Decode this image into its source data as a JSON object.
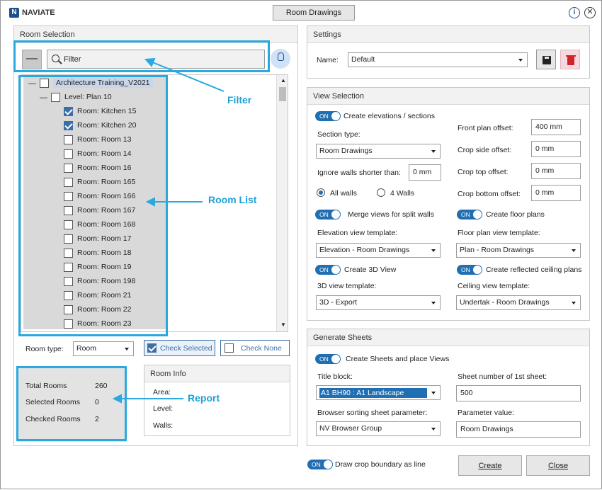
{
  "app": {
    "logo": "NAVIATE",
    "title_tab": "Room Drawings"
  },
  "room_selection": {
    "title": "Room Selection",
    "filter_placeholder": "Filter",
    "tree_root": "Architecture Training_V2021",
    "tree_level": "Level: Plan 10",
    "rooms": [
      {
        "label": "Room: Kitchen 15",
        "checked": true
      },
      {
        "label": "Room: Kitchen 20",
        "checked": true
      },
      {
        "label": "Room: Room 13",
        "checked": false
      },
      {
        "label": "Room: Room 14",
        "checked": false
      },
      {
        "label": "Room: Room 16",
        "checked": false
      },
      {
        "label": "Room: Room 165",
        "checked": false
      },
      {
        "label": "Room: Room 166",
        "checked": false
      },
      {
        "label": "Room: Room 167",
        "checked": false
      },
      {
        "label": "Room: Room 168",
        "checked": false
      },
      {
        "label": "Room: Room 17",
        "checked": false
      },
      {
        "label": "Room: Room 18",
        "checked": false
      },
      {
        "label": "Room: Room 19",
        "checked": false
      },
      {
        "label": "Room: Room 198",
        "checked": false
      },
      {
        "label": "Room: Room 21",
        "checked": false
      },
      {
        "label": "Room: Room 22",
        "checked": false
      },
      {
        "label": "Room: Room 23",
        "checked": false
      }
    ],
    "room_type_label": "Room type:",
    "room_type_value": "Room",
    "check_selected": "Check Selected",
    "check_none": "Check None"
  },
  "report": {
    "total_label": "Total Rooms",
    "total_value": "260",
    "selected_label": "Selected Rooms",
    "selected_value": "0",
    "checked_label": "Checked Rooms",
    "checked_value": "2"
  },
  "room_info": {
    "title": "Room Info",
    "area": "Area:",
    "level": "Level:",
    "walls": "Walls:"
  },
  "annotations": {
    "filter": "Filter",
    "room_list": "Room List",
    "report": "Report"
  },
  "settings": {
    "title": "Settings",
    "name_label": "Name:",
    "name_value": "Default"
  },
  "view_selection": {
    "title": "View Selection",
    "create_elevations": "Create elevations / sections",
    "section_type_label": "Section type:",
    "section_type_value": "Room Drawings",
    "ignore_walls_label": "Ignore walls shorter than:",
    "ignore_walls_value": "0 mm",
    "all_walls": "All walls",
    "four_walls": "4 Walls",
    "merge_views": "Merge views for split walls",
    "elevation_template_label": "Elevation view template:",
    "elevation_template_value": "Elevation - Room Drawings",
    "create_3d": "Create 3D View",
    "template_3d_label": "3D view template:",
    "template_3d_value": "3D - Export",
    "front_plan_label": "Front plan offset:",
    "front_plan_value": "400 mm",
    "crop_side_label": "Crop side offset:",
    "crop_side_value": "0 mm",
    "crop_top_label": "Crop top offset:",
    "crop_top_value": "0 mm",
    "crop_bottom_label": "Crop bottom offset:",
    "crop_bottom_value": "0 mm",
    "create_floor_plans": "Create floor plans",
    "floor_plan_template_label": "Floor plan view template:",
    "floor_plan_template_value": "Plan - Room Drawings",
    "create_rcp": "Create reflected ceiling plans",
    "ceiling_template_label": "Ceiling view template:",
    "ceiling_template_value": "Undertak - Room Drawings"
  },
  "generate_sheets": {
    "title": "Generate Sheets",
    "create_sheets": "Create Sheets and place Views",
    "title_block_label": "Title block:",
    "title_block_value": "A1 BH90 : A1 Landscape",
    "sheet_number_label": "Sheet number of 1st sheet:",
    "sheet_number_value": "500",
    "browser_param_label": "Browser sorting sheet parameter:",
    "browser_param_value": "NV Browser Group",
    "param_value_label": "Parameter value:",
    "param_value_value": "Room Drawings"
  },
  "footer": {
    "toggle_on": "ON",
    "draw_crop": "Draw crop boundary as line",
    "create": "Create",
    "close": "Close"
  }
}
